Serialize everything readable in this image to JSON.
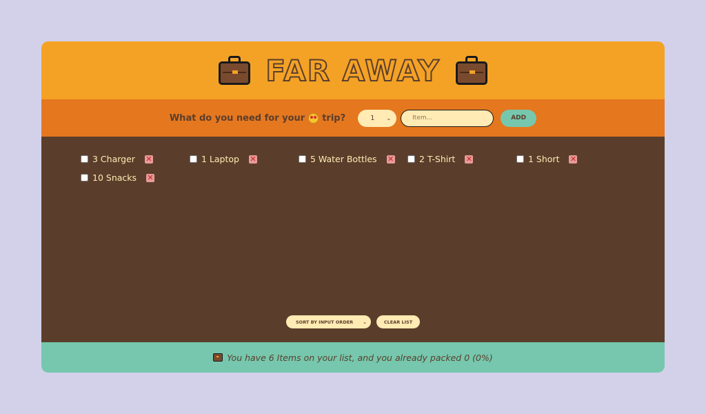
{
  "header": {
    "title": "FAR AWAY",
    "icon": "briefcase-icon"
  },
  "form": {
    "question_prefix": "What do you need for your",
    "question_suffix": "trip?",
    "emoji": "star-eyes-face-icon",
    "quantity_value": "1",
    "item_placeholder": "Item...",
    "add_label": "ADD"
  },
  "items": [
    {
      "label": "3 Charger",
      "packed": false
    },
    {
      "label": "1 Laptop",
      "packed": false
    },
    {
      "label": "5 Water Bottles",
      "packed": false
    },
    {
      "label": "2 T-Shirt",
      "packed": false
    },
    {
      "label": "1 Short",
      "packed": false
    },
    {
      "label": "10 Snacks",
      "packed": false
    }
  ],
  "actions": {
    "sort_value": "SORT BY INPUT ORDER",
    "clear_label": "CLEAR LIST"
  },
  "stats": {
    "text": "You have 6 Items on your list, and you already packed 0 (0%)"
  },
  "colors": {
    "header": "#f4a226",
    "form_bar": "#e5771f",
    "list_bg": "#5a3e2b",
    "stats_bg": "#76c7ad",
    "cream": "#ffebb3",
    "page_bg": "#d3d1ea"
  }
}
